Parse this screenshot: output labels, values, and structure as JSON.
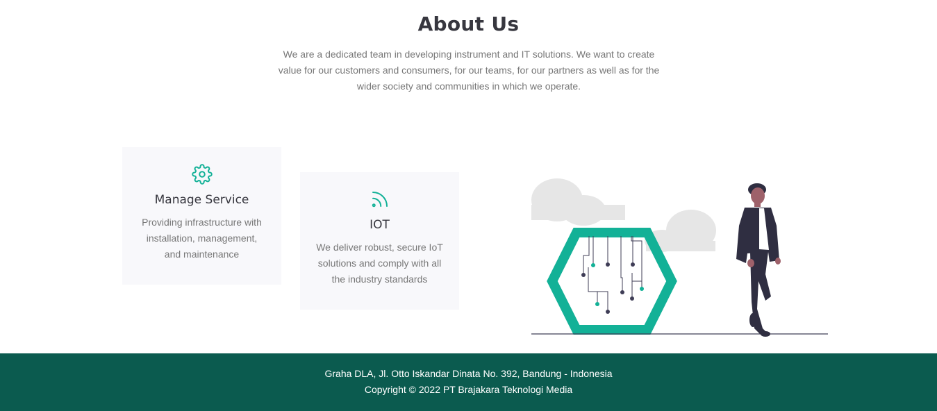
{
  "about": {
    "title": "About Us",
    "description": "We are a dedicated team in developing instrument and IT solutions. We want to create value for our customers and consumers, for our teams, for our partners as well as for the wider society and communities in which we operate."
  },
  "services": [
    {
      "icon": "gear-icon",
      "title": "Manage Service",
      "text": "Providing infrastructure with installation, management, and maintenance"
    },
    {
      "icon": "signal-icon",
      "title": "IOT",
      "text": "We deliver robust, secure IoT solutions and comply with all the industry standards"
    }
  ],
  "footer": {
    "address": "Graha DLA, Jl. Otto Iskandar Dinata No. 392, Bandung - Indonesia",
    "copyright": "Copyright © 2022 PT Brajakara Teknologi Media"
  },
  "colors": {
    "accent": "#13b197",
    "footer_bg": "#0b5b4f",
    "heading": "#37373f",
    "card_bg": "#f8f8fb"
  }
}
